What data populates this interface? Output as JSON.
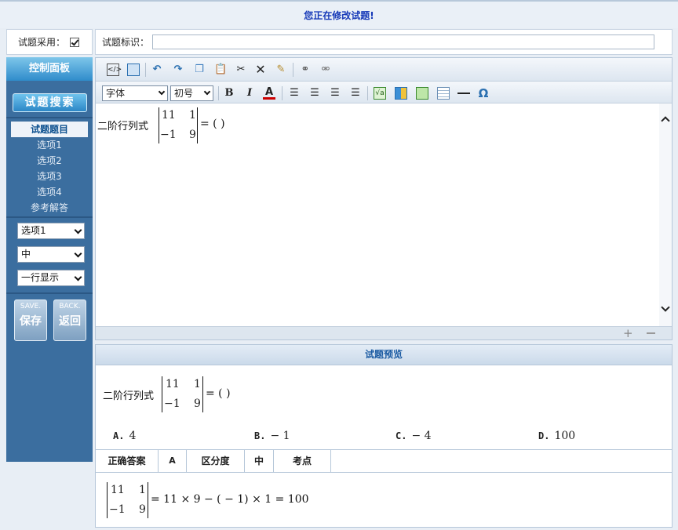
{
  "banner": {
    "text": "您正在修改试题!"
  },
  "adopt": {
    "label": "试题采用：",
    "checked": true
  },
  "ident": {
    "label": "试题标识：",
    "value": ""
  },
  "sidebar": {
    "title": "控制面板",
    "search_button": "试题搜索",
    "nav": [
      "试题题目",
      "选项1",
      "选项2",
      "选项3",
      "选项4",
      "参考解答"
    ],
    "active_nav": "试题题目",
    "selects": [
      "选项1",
      "中",
      "一行显示"
    ],
    "save": {
      "en": "SAVE.",
      "cn": "保存"
    },
    "back": {
      "en": "BACK.",
      "cn": "返回"
    }
  },
  "toolbar": {
    "font_family": "字体",
    "font_size": "初号",
    "icons": [
      "source-icon",
      "preview-icon",
      "undo-icon",
      "redo-icon",
      "copy-icon",
      "paste-icon",
      "cut-icon",
      "delete-icon",
      "clean-icon",
      "link-icon",
      "unlink-icon",
      "bold-icon",
      "italic-icon",
      "font-color-icon",
      "justify-icon",
      "align-center-icon",
      "align-left-icon",
      "align-right-icon",
      "formula-icon",
      "layout-icon",
      "image-icon",
      "table-icon",
      "horizontal-rule-icon",
      "special-char-icon"
    ]
  },
  "question": {
    "prefix": "二阶行列式",
    "matrix": [
      [
        "11",
        "1"
      ],
      [
        "−1",
        "9"
      ]
    ],
    "suffix": "= ( )"
  },
  "preview": {
    "title": "试题预览",
    "options": [
      {
        "key": "A.",
        "value": "4"
      },
      {
        "key": "B.",
        "value": "− 1"
      },
      {
        "key": "C.",
        "value": "− 4"
      },
      {
        "key": "D.",
        "value": "100"
      }
    ]
  },
  "answer": {
    "correct_label": "正确答案",
    "correct_value": "A",
    "difficulty_label": "区分度",
    "difficulty_value": "中",
    "point_label": "考点",
    "point_value": ""
  },
  "solution": {
    "matrix": [
      [
        "11",
        "1"
      ],
      [
        "−1",
        "9"
      ]
    ],
    "expression": "= 11 × 9 − ( − 1) × 1 = 100"
  }
}
